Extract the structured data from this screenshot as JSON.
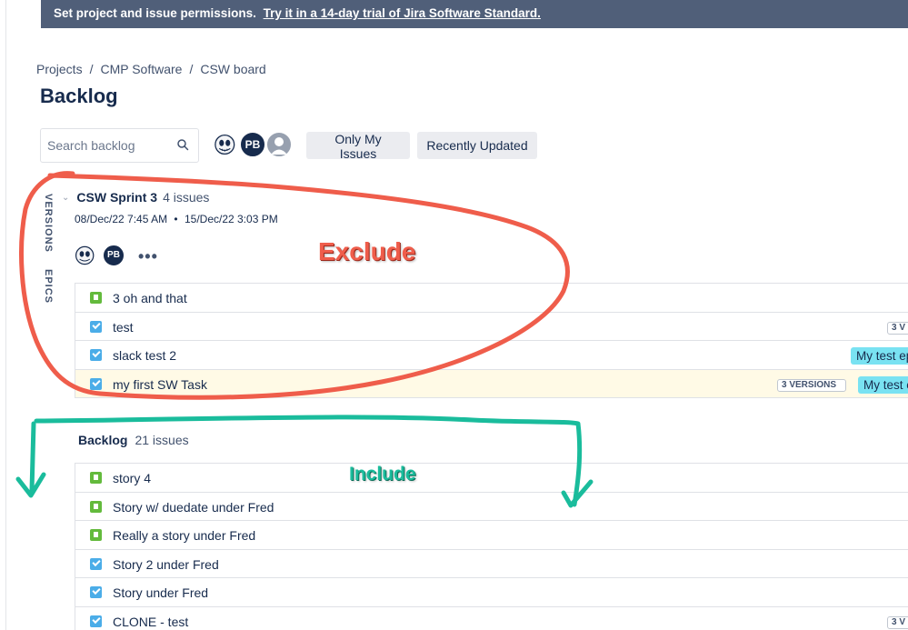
{
  "banner": {
    "text": "Set project and issue permissions.",
    "link": "Try it in a 14-day trial of Jira Software Standard."
  },
  "breadcrumb": [
    "Projects",
    "CMP Software",
    "CSW board"
  ],
  "page_title": "Backlog",
  "search": {
    "placeholder": "Search backlog"
  },
  "avatars": [
    {
      "name": "jack-skull-avatar",
      "initials": ""
    },
    {
      "name": "pb-avatar",
      "initials": "PB"
    },
    {
      "name": "default-user-avatar",
      "initials": ""
    }
  ],
  "filters": [
    "Only My Issues",
    "Recently Updated"
  ],
  "side_tabs": [
    "VERSIONS",
    "EPICS"
  ],
  "sprint": {
    "name": "CSW Sprint 3",
    "count": "4 issues",
    "start": "08/Dec/22 7:45 AM",
    "dot": "•",
    "end": "15/Dec/22 3:03 PM",
    "more": "•••",
    "pb": "PB",
    "issues": [
      {
        "type": "story",
        "summary": "3 oh and that"
      },
      {
        "type": "task",
        "summary": "test",
        "version": "3 V"
      },
      {
        "type": "task",
        "summary": "slack test 2",
        "epic": "My test ep"
      },
      {
        "type": "task",
        "summary": "my first SW Task",
        "version": "3 VERSIONS",
        "epic": "My test e",
        "highlight": true
      }
    ]
  },
  "backlog": {
    "name": "Backlog",
    "count": "21 issues",
    "issues": [
      {
        "type": "story",
        "summary": "story 4"
      },
      {
        "type": "story",
        "summary": "Story w/ duedate under Fred"
      },
      {
        "type": "story",
        "summary": "Really a story under Fred"
      },
      {
        "type": "task",
        "summary": "Story 2 under Fred"
      },
      {
        "type": "task",
        "summary": "Story under Fred"
      },
      {
        "type": "task",
        "summary": "CLONE - test",
        "version": "3 V"
      }
    ]
  },
  "annotations": {
    "exclude": {
      "text": "Exclude",
      "color": "#ef5d4b"
    },
    "include": {
      "text": "Include",
      "color": "#1abc9c"
    }
  },
  "colors": {
    "banner": "#505f79",
    "story": "#63ba3c",
    "task": "#4bade8",
    "epic": "#79e2f2",
    "highlight_row": "#fffae6"
  }
}
